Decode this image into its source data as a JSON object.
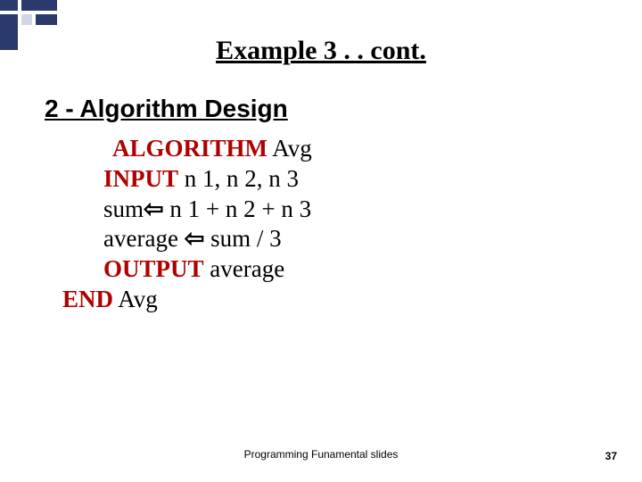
{
  "title": "Example 3 . . cont.",
  "subhead": "2 - Algorithm Design",
  "algo": {
    "kw_algorithm": "ALGORITHM",
    "name1": "Avg",
    "kw_input": "INPUT",
    "inputs": "n 1, n 2, n 3",
    "sum_lhs": "sum",
    "sum_rhs": "n 1 + n 2 + n 3",
    "avg_lhs": "average",
    "avg_rhs": "sum / 3",
    "kw_output": "OUTPUT",
    "output_expr": "average",
    "kw_end": "END",
    "name2": "Avg"
  },
  "arrow": "⇦",
  "footer": "Programming Funamental slides",
  "pagenum": "37",
  "deco": {
    "dark": "#2a3a6a",
    "light": "#cfd6e6"
  }
}
